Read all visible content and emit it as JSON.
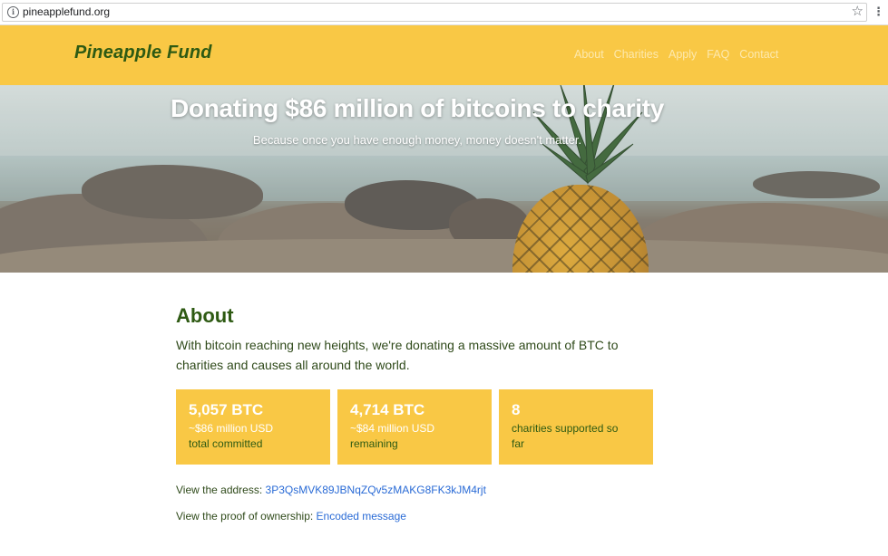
{
  "browser": {
    "url": "pineapplefund.org"
  },
  "header": {
    "brand": "Pineapple Fund",
    "nav": [
      "About",
      "Charities",
      "Apply",
      "FAQ",
      "Contact"
    ]
  },
  "hero": {
    "title": "Donating $86 million of bitcoins to charity",
    "subtitle": "Because once you have enough money, money doesn't matter."
  },
  "about": {
    "title": "About",
    "text": "With bitcoin reaching new heights, we're donating a massive amount of BTC to charities and causes all around the world.",
    "stats": [
      {
        "big": "5,057 BTC",
        "line1": "~$86 million USD",
        "line2": "total committed"
      },
      {
        "big": "4,714 BTC",
        "line1": "~$84 million USD",
        "line2": "remaining"
      },
      {
        "big": "8",
        "line1": "charities supported so",
        "line2": "far"
      }
    ],
    "address_label": "View the address:",
    "address_value": "3P3QsMVK89JBNqZQv5zMAKG8FK3kJM4rjt",
    "proof_label": "View the proof of ownership:",
    "proof_link": "Encoded message"
  },
  "colors": {
    "accent_yellow": "#f9c845",
    "brand_green": "#2e5a13",
    "link_blue": "#2a6bd6"
  }
}
